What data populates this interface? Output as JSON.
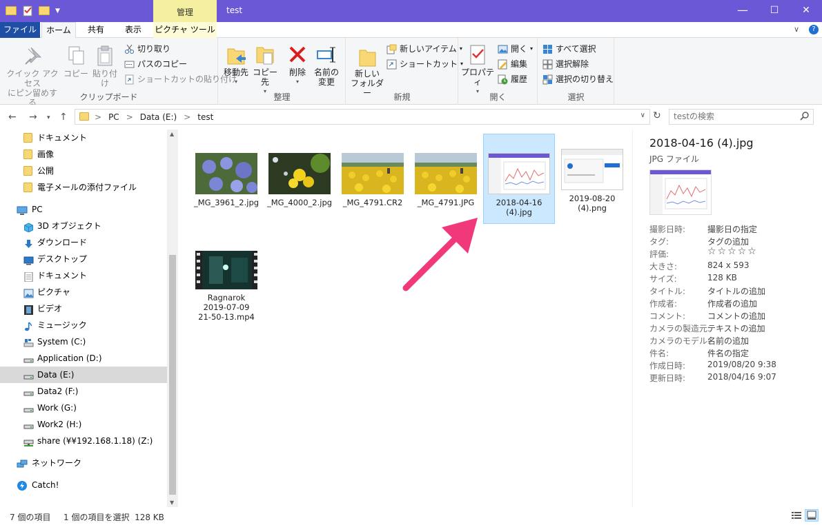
{
  "window": {
    "title": "test",
    "manage_tab": "管理",
    "minimize": "—",
    "maximize": "☐",
    "close": "✕"
  },
  "tabs": {
    "file": "ファイル",
    "home": "ホーム",
    "share": "共有",
    "view": "表示",
    "picture_tools": "ピクチャ ツール",
    "collapse": "∨",
    "help": "?"
  },
  "ribbon": {
    "clipboard": {
      "label": "クリップボード",
      "pin": "クイック アクセス\nにピン留めする",
      "pin_line1": "クイック アクセス",
      "pin_line2": "にピン留めする",
      "copy": "コピー",
      "paste": "貼り付け",
      "cut": "切り取り",
      "copy_path": "パスのコピー",
      "paste_shortcut": "ショートカットの貼り付け"
    },
    "organize": {
      "label": "整理",
      "move_to": "移動先",
      "copy_to": "コピー先",
      "delete": "削除",
      "rename_line1": "名前の",
      "rename_line2": "変更"
    },
    "new": {
      "label": "新規",
      "new_folder_line1": "新しい",
      "new_folder_line2": "フォルダー",
      "new_item": "新しいアイテム",
      "shortcut": "ショートカット"
    },
    "open": {
      "label": "開く",
      "properties": "プロパティ",
      "open": "開く",
      "edit": "編集",
      "history": "履歴"
    },
    "select": {
      "label": "選択",
      "select_all": "すべて選択",
      "select_none": "選択解除",
      "invert": "選択の切り替え"
    }
  },
  "address": {
    "crumbs": [
      "PC",
      "Data (E:)",
      "test"
    ],
    "sep": ">",
    "search_placeholder": "testの検索"
  },
  "nav": {
    "items": [
      {
        "label": "ドキュメント"
      },
      {
        "label": "画像"
      },
      {
        "label": "公開"
      },
      {
        "label": "電子メールの添付ファイル"
      },
      {
        "label": "PC"
      },
      {
        "label": "3D オブジェクト"
      },
      {
        "label": "ダウンロード"
      },
      {
        "label": "デスクトップ"
      },
      {
        "label": "ドキュメント"
      },
      {
        "label": "ピクチャ"
      },
      {
        "label": "ビデオ"
      },
      {
        "label": "ミュージック"
      },
      {
        "label": "System (C:)"
      },
      {
        "label": "Application (D:)"
      },
      {
        "label": "Data (E:)"
      },
      {
        "label": "Data2 (F:)"
      },
      {
        "label": "Work (G:)"
      },
      {
        "label": "Work2 (H:)"
      },
      {
        "label": "share (¥¥192.168.1.18) (Z:)"
      },
      {
        "label": "ネットワーク"
      },
      {
        "label": "Catch!"
      }
    ]
  },
  "files": [
    {
      "line1": "_MG_3961_2.jpg",
      "line2": "",
      "line3": ""
    },
    {
      "line1": "_MG_4000_2.jpg",
      "line2": "",
      "line3": ""
    },
    {
      "line1": "_MG_4791.CR2",
      "line2": "",
      "line3": ""
    },
    {
      "line1": "_MG_4791.JPG",
      "line2": "",
      "line3": ""
    },
    {
      "line1": "2018-04-16",
      "line2": "(4).jpg",
      "line3": ""
    },
    {
      "line1": "2019-08-20",
      "line2": "(4).png",
      "line3": ""
    },
    {
      "line1": "Ragnarok",
      "line2": "2019-07-09",
      "line3": "21-50-13.mp4"
    }
  ],
  "details": {
    "title": "2018-04-16 (4).jpg",
    "type": "JPG ファイル",
    "rows": [
      {
        "k": "撮影日時:",
        "v": "撮影日の指定"
      },
      {
        "k": "タグ:",
        "v": "タグの追加"
      },
      {
        "k": "評価:",
        "v": "☆☆☆☆☆"
      },
      {
        "k": "大きさ:",
        "v": "824 x 593"
      },
      {
        "k": "サイズ:",
        "v": "128 KB"
      },
      {
        "k": "タイトル:",
        "v": "タイトルの追加"
      },
      {
        "k": "作成者:",
        "v": "作成者の追加"
      },
      {
        "k": "コメント:",
        "v": "コメントの追加"
      },
      {
        "k": "カメラの製造元:",
        "v": "テキストの追加"
      },
      {
        "k": "カメラのモデル:",
        "v": "名前の追加"
      },
      {
        "k": "件名:",
        "v": "件名の指定"
      },
      {
        "k": "作成日時:",
        "v": "2019/08/20 9:38"
      },
      {
        "k": "更新日時:",
        "v": "2018/04/16 9:07"
      }
    ]
  },
  "status": {
    "count": "7 個の項目",
    "selected": "1 個の項目を選択  128 KB"
  },
  "colors": {
    "titlebar": "#6b58d6",
    "file_tab": "#1e4fa5",
    "selection": "#cce8ff",
    "arrow": "#f0387a"
  }
}
